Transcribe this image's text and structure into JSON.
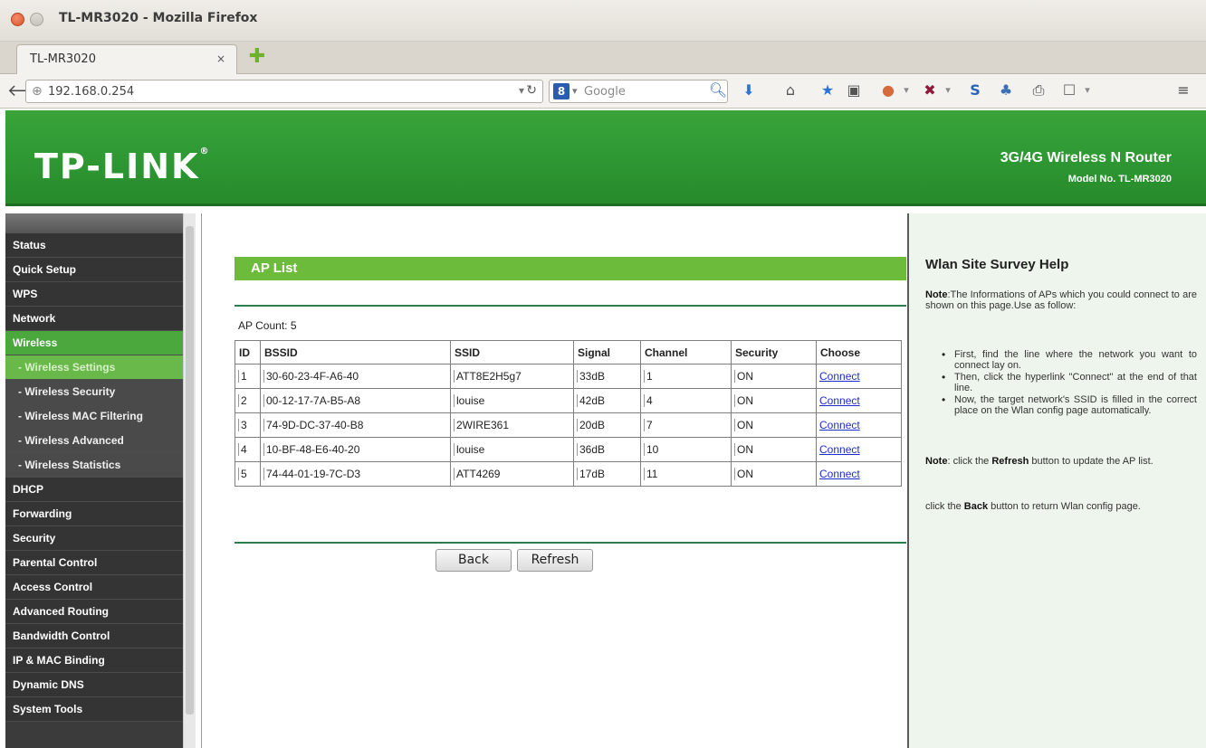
{
  "browser": {
    "window_title": "TL-MR3020 - Mozilla Firefox",
    "tab_title": "TL-MR3020",
    "tab_close": "×",
    "url": "192.168.0.254",
    "search_placeholder": "Google",
    "search_engine_letter": "8",
    "toolbar_icons": [
      "download-icon",
      "home-icon",
      "bookmark-star-icon",
      "bookmarks-menu-icon",
      "addon-icon",
      "addon-icon",
      "addon-icon",
      "addon-icon",
      "print-icon",
      "addon-icon",
      "menu-icon"
    ]
  },
  "header": {
    "logo": "TP-LINK",
    "logo_mark": "®",
    "product": "3G/4G Wireless N Router",
    "model": "Model No. TL-MR3020"
  },
  "sidebar": {
    "items": [
      {
        "label": "Status"
      },
      {
        "label": "Quick Setup"
      },
      {
        "label": "WPS"
      },
      {
        "label": "Network"
      },
      {
        "label": "Wireless"
      },
      {
        "label": "- Wireless Settings"
      },
      {
        "label": "- Wireless Security"
      },
      {
        "label": "- Wireless MAC Filtering"
      },
      {
        "label": "- Wireless Advanced"
      },
      {
        "label": "- Wireless Statistics"
      },
      {
        "label": "DHCP"
      },
      {
        "label": "Forwarding"
      },
      {
        "label": "Security"
      },
      {
        "label": "Parental Control"
      },
      {
        "label": "Access Control"
      },
      {
        "label": "Advanced Routing"
      },
      {
        "label": "Bandwidth Control"
      },
      {
        "label": "IP & MAC Binding"
      },
      {
        "label": "Dynamic DNS"
      },
      {
        "label": "System Tools"
      }
    ]
  },
  "main": {
    "section_title": "AP List",
    "ap_count_label": "AP Count:",
    "ap_count": "5",
    "columns": [
      "ID",
      "BSSID",
      "SSID",
      "Signal",
      "Channel",
      "Security",
      "Choose"
    ],
    "rows": [
      [
        "1",
        "30-60-23-4F-A6-40",
        "ATT8E2H5g7",
        "33dB",
        "1",
        "ON",
        "Connect"
      ],
      [
        "2",
        "00-12-17-7A-B5-A8",
        "louise",
        "42dB",
        "4",
        "ON",
        "Connect"
      ],
      [
        "3",
        "74-9D-DC-37-40-B8",
        "2WIRE361",
        "20dB",
        "7",
        "ON",
        "Connect"
      ],
      [
        "4",
        "10-BF-48-E6-40-20",
        "louise",
        "36dB",
        "10",
        "ON",
        "Connect"
      ],
      [
        "5",
        "74-44-01-19-7C-D3",
        "ATT4269",
        "17dB",
        "11",
        "ON",
        "Connect"
      ]
    ],
    "back_label": "Back",
    "refresh_label": "Refresh"
  },
  "help": {
    "title": "Wlan Site Survey Help",
    "note_label": "Note",
    "note_text": ":The Informations of APs which you could connect to are shown on this page.Use as follow:",
    "bullets": [
      "First, find the line where the network you want to connect lay on.",
      "Then, click the hyperlink \"Connect\" at the end of that line.",
      "Now, the target network's SSID is filled in the correct place on the Wlan config page automatically."
    ],
    "note2_label": "Note",
    "note2_pre": ": click the ",
    "note2_refresh": "Refresh",
    "note2_post": " button to update the AP list.",
    "back_pre": "click the ",
    "back_word": "Back",
    "back_post": " button to return Wlan config page."
  }
}
